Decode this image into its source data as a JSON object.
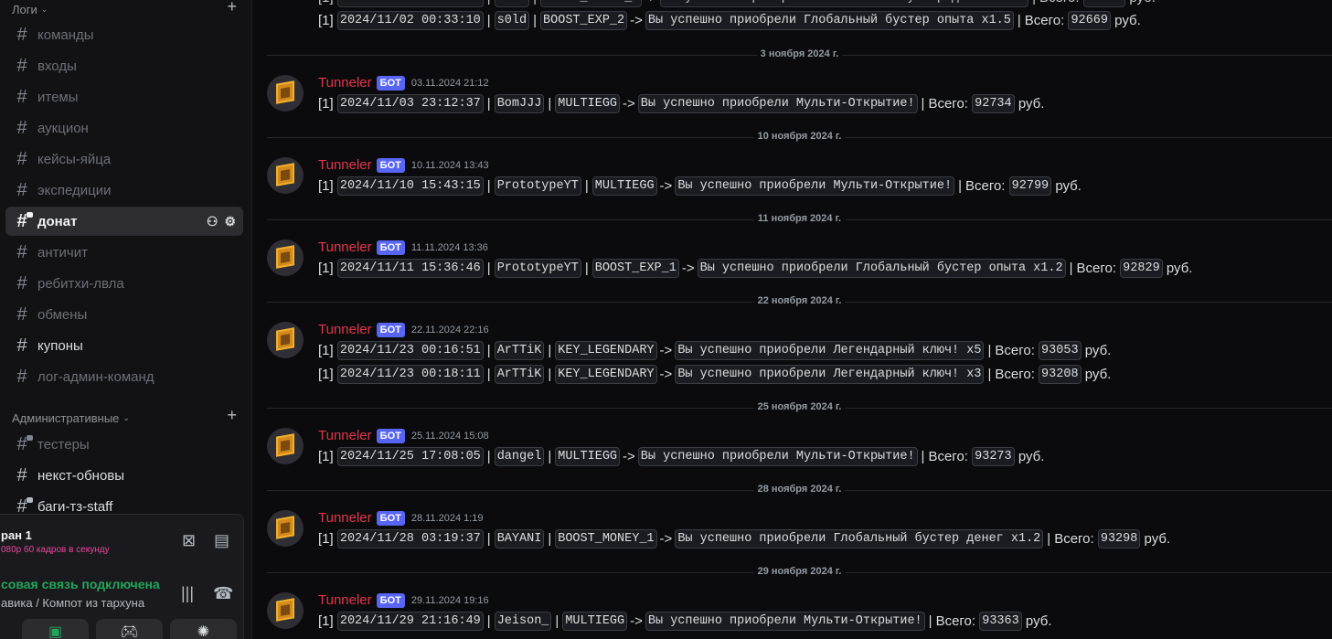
{
  "sidebar": {
    "category_logs": "Логи",
    "category_admin": "Административные",
    "channels_logs": [
      "команды",
      "входы",
      "итемы",
      "аукцион",
      "кейсы-яйца",
      "экспедиции",
      "донат",
      "античит",
      "ребитхи-лвла",
      "обмены",
      "купоны",
      "лог-админ-команд"
    ],
    "channels_admin": [
      "тестеры",
      "некст-обновы",
      "баги-тз-staff"
    ],
    "active_channel": "донат"
  },
  "voice_panel": {
    "stream_name": "ран 1",
    "stream_quality": "080р 60 кадров в секунду",
    "status": "совая связь подключена",
    "channel": "авика / Компот из тархуна"
  },
  "chat": {
    "top_messages": [
      {
        "prefix": "[1]",
        "datetime": "2024/11/02 00:33:10",
        "user": "s0ld",
        "item": "BOOST_EXP_2",
        "text": "Вы успешно приобрели Глобальный бустер опыта x1.5",
        "total_label": "Всего:",
        "total": "92669",
        "currency": "руб."
      }
    ],
    "groups": [
      {
        "date": "3 ноября 2024 г.",
        "author": "Tunneler",
        "badge": "БОТ",
        "timestamp": "03.11.2024 21:12",
        "messages": [
          {
            "prefix": "[1]",
            "datetime": "2024/11/03 23:12:37",
            "user": "BomJJJ",
            "item": "MULTIEGG",
            "text": "Вы успешно приобрели Мульти-Открытие!",
            "total_label": "Всего:",
            "total": "92734",
            "currency": "руб."
          }
        ]
      },
      {
        "date": "10 ноября 2024 г.",
        "author": "Tunneler",
        "badge": "БОТ",
        "timestamp": "10.11.2024 13:43",
        "messages": [
          {
            "prefix": "[1]",
            "datetime": "2024/11/10 15:43:15",
            "user": "PrototypeYT",
            "item": "MULTIEGG",
            "text": "Вы успешно приобрели Мульти-Открытие!",
            "total_label": "Всего:",
            "total": "92799",
            "currency": "руб."
          }
        ]
      },
      {
        "date": "11 ноября 2024 г.",
        "author": "Tunneler",
        "badge": "БОТ",
        "timestamp": "11.11.2024 13:36",
        "messages": [
          {
            "prefix": "[1]",
            "datetime": "2024/11/11 15:36:46",
            "user": "PrototypeYT",
            "item": "BOOST_EXP_1",
            "text": "Вы успешно приобрели Глобальный бустер опыта x1.2",
            "total_label": "Всего:",
            "total": "92829",
            "currency": "руб."
          }
        ]
      },
      {
        "date": "22 ноября 2024 г.",
        "author": "Tunneler",
        "badge": "БОТ",
        "timestamp": "22.11.2024 22:16",
        "messages": [
          {
            "prefix": "[1]",
            "datetime": "2024/11/23 00:16:51",
            "user": "ArTTiK",
            "item": "KEY_LEGENDARY",
            "text": "Вы успешно приобрели Легендарный ключ! x5",
            "total_label": "Всего:",
            "total": "93053",
            "currency": "руб."
          },
          {
            "prefix": "[1]",
            "datetime": "2024/11/23 00:18:11",
            "user": "ArTTiK",
            "item": "KEY_LEGENDARY",
            "text": "Вы успешно приобрели Легендарный ключ! x3",
            "total_label": "Всего:",
            "total": "93208",
            "currency": "руб."
          }
        ]
      },
      {
        "date": "25 ноября 2024 г.",
        "author": "Tunneler",
        "badge": "БОТ",
        "timestamp": "25.11.2024 15:08",
        "messages": [
          {
            "prefix": "[1]",
            "datetime": "2024/11/25 17:08:05",
            "user": "dangel",
            "item": "MULTIEGG",
            "text": "Вы успешно приобрели Мульти-Открытие!",
            "total_label": "Всего:",
            "total": "93273",
            "currency": "руб."
          }
        ]
      },
      {
        "date": "28 ноября 2024 г.",
        "author": "Tunneler",
        "badge": "БОТ",
        "timestamp": "28.11.2024 1:19",
        "messages": [
          {
            "prefix": "[1]",
            "datetime": "2024/11/28 03:19:37",
            "user": "BAYANI",
            "item": "BOOST_MONEY_1",
            "text": "Вы успешно приобрели Глобальный бустер денег x1.2",
            "total_label": "Всего:",
            "total": "93298",
            "currency": "руб."
          }
        ]
      },
      {
        "date": "29 ноября 2024 г.",
        "author": "Tunneler",
        "badge": "БОТ",
        "timestamp": "29.11.2024 19:16",
        "messages": [
          {
            "prefix": "[1]",
            "datetime": "2024/11/29 21:16:49",
            "user": "Jeison_",
            "item": "MULTIEGG",
            "text": "Вы успешно приобрели Мульти-Открытие!",
            "total_label": "Всего:",
            "total": "93363",
            "currency": "руб."
          }
        ]
      }
    ]
  },
  "colors": {
    "bot_name": "#e1374b",
    "bot_badge": "#5865f2",
    "voice_connected": "#23a55a",
    "stream_sub": "#eb459e"
  }
}
